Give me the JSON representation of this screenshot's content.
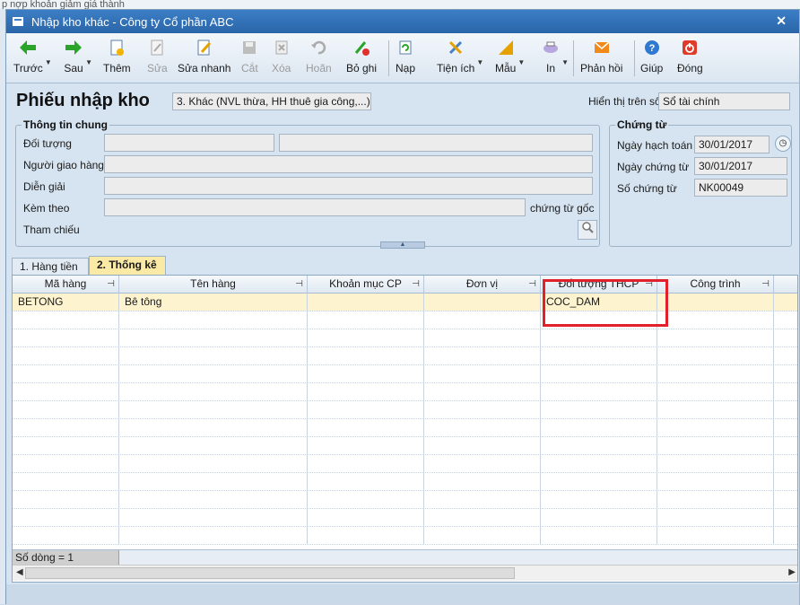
{
  "background": {
    "text": "p nợp khoản giảm giá thành"
  },
  "window": {
    "title": "Nhập kho khác - Công ty Cổ phần ABC"
  },
  "toolbar": {
    "prev": "Trước",
    "next": "Sau",
    "add": "Thêm",
    "edit": "Sửa",
    "quick_edit": "Sửa nhanh",
    "cut": "Cắt",
    "delete": "Xóa",
    "undo": "Hoãn",
    "unpost": "Bỏ ghi",
    "reload": "Nạp",
    "utilities": "Tiện ích",
    "template": "Mẫu",
    "print": "In",
    "feedback": "Phản hồi",
    "help": "Giúp",
    "close": "Đóng"
  },
  "header": {
    "title": "Phiếu nhập kho",
    "type_value": "3. Khác (NVL thừa, HH thuê gia công,...)",
    "display_label": "Hiển thị trên sổ",
    "display_value": "Sổ tài chính"
  },
  "general": {
    "title": "Thông tin chung",
    "object_label": "Đối tượng",
    "deliverer_label": "Người giao hàng",
    "description_label": "Diễn giải",
    "attach_label": "Kèm theo",
    "attach_suffix": "chứng từ gốc",
    "reference_label": "Tham chiếu"
  },
  "voucher": {
    "title": "Chứng từ",
    "posting_date_label": "Ngày hạch toán",
    "posting_date": "30/01/2017",
    "voucher_date_label": "Ngày chứng từ",
    "voucher_date": "30/01/2017",
    "voucher_no_label": "Số chứng từ",
    "voucher_no": "NK00049"
  },
  "tabs": [
    {
      "label": "1. Hàng tiền"
    },
    {
      "label": "2. Thống kê"
    }
  ],
  "grid": {
    "columns": [
      "Mã hàng",
      "Tên hàng",
      "Khoản mục CP",
      "Đơn vị",
      "Đối tượng THCP",
      "Công trình"
    ],
    "rows": [
      [
        "BETONG",
        "Bê tông",
        "",
        "",
        "COC_DAM",
        ""
      ]
    ],
    "row_count": "Số dòng = 1"
  },
  "colors": {
    "highlight": "#e0202a",
    "active_tab": "#fbe9a6",
    "selected_row": "#fdf3cf"
  }
}
